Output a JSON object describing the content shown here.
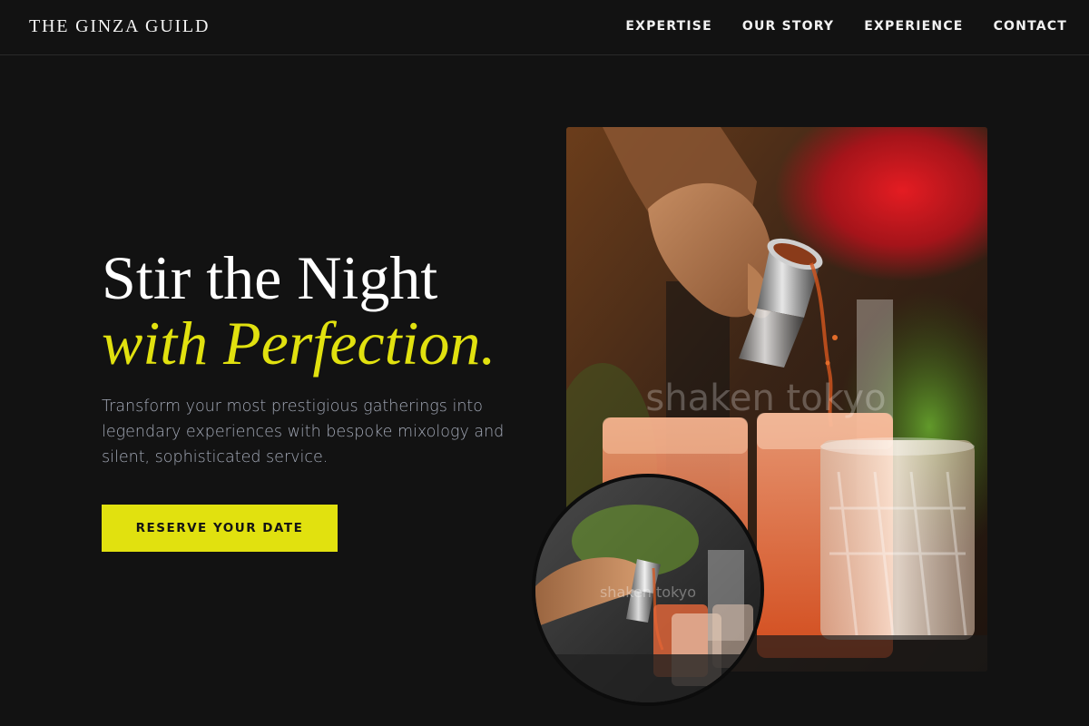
{
  "site": {
    "brand": "THE GINZA GUILD"
  },
  "nav": {
    "items": [
      {
        "label": "EXPERTISE"
      },
      {
        "label": "OUR STORY"
      },
      {
        "label": "EXPERIENCE"
      },
      {
        "label": "CONTACT"
      }
    ]
  },
  "hero": {
    "headline_line1": "Stir the Night",
    "headline_line2": "with Perfection.",
    "subcopy": "Transform your most prestigious gatherings into legendary experiences with bespoke mixology and silent, sophisticated service.",
    "cta_label": "RESERVE YOUR DATE"
  },
  "images": {
    "main_watermark": "shaken tokyo",
    "inset_watermark": "shaken tokyo"
  },
  "colors": {
    "background": "#121212",
    "accent": "#e1e10f",
    "text_muted": "#a3a9b7",
    "text_light": "#ffffff"
  }
}
